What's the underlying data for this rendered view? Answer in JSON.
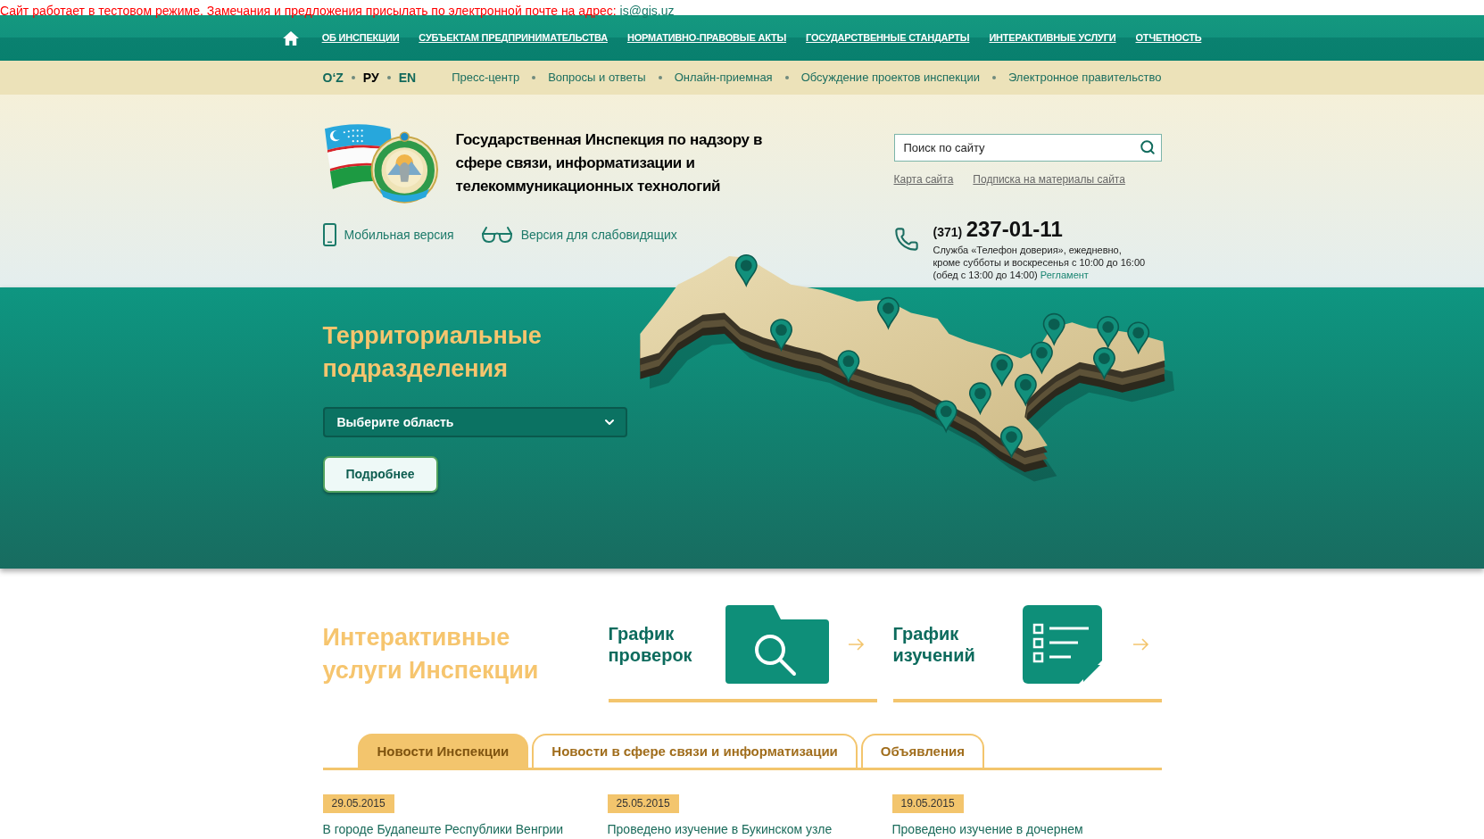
{
  "notice": {
    "text": "Сайт работает в тестовом режиме. Замечания и предложения присылать по электронной почте на адрес:",
    "email": "is@gis.uz"
  },
  "main_nav": {
    "items": [
      "ОБ ИНСПЕКЦИИ",
      "СУБЪЕКТАМ ПРЕДПРИНИМАТЕЛЬСТВА",
      "НОРМАТИВНО-ПРАВОВЫЕ АКТЫ",
      "ГОСУДАРСТВЕННЫЕ СТАНДАРТЫ",
      "ИНТЕРАКТИВНЫЕ УСЛУГИ",
      "ОТЧЕТНОСТЬ"
    ]
  },
  "languages": [
    {
      "label": "O‘Z",
      "selected": false
    },
    {
      "label": "РУ",
      "selected": true
    },
    {
      "label": "EN",
      "selected": false
    }
  ],
  "top_links": [
    "Пресс-центр",
    "Вопросы и ответы",
    "Онлайн-приемная",
    "Обсуждение проектов инспекции",
    "Электронное правительство"
  ],
  "header": {
    "title_lines": [
      "Государственная Инспекция по надзору в",
      "сфере связи, информатизации и",
      "телекоммуникационных технологий"
    ],
    "links": [
      {
        "kind": "mobile",
        "label": "Мобильная версия"
      },
      {
        "kind": "low_vision",
        "label": "Версия для слабовидящих"
      }
    ],
    "search": {
      "placeholder": "Поиск по сайту"
    },
    "site_links": [
      "Карта сайта",
      "Подписка на материалы сайта"
    ],
    "phone": {
      "code": "(371)",
      "number": "237-01-11",
      "note_lines": [
        "Служба «Телефон доверия», ежедневно,",
        "кроме субботы и воскресенья с 10:00 до 16:00",
        "(обед с 13:00 до 14:00)"
      ],
      "link": "Регламент"
    }
  },
  "territorial": {
    "title": "Территориальные подразделения",
    "select": {
      "value": "Выберите область"
    },
    "button": "Подробнее"
  },
  "interactive": {
    "title": "Интерактивные услуги Инспекции",
    "services": [
      {
        "kind": "folder_search",
        "title": "График проверок"
      },
      {
        "kind": "checklist",
        "title": "График изучений"
      }
    ]
  },
  "news_tabs": [
    {
      "label": "Новости Инспекции",
      "selected": true
    },
    {
      "label": "Новости в сфере связи и информатизации",
      "selected": false
    },
    {
      "label": "Объявления",
      "selected": false
    }
  ],
  "news": [
    {
      "date": "29.05.2015",
      "title": "В городе Будапеште Республики Венгрии"
    },
    {
      "date": "25.05.2015",
      "title": "Проведено изучение в Букинском узле"
    },
    {
      "date": "19.05.2015",
      "title": "Проведено изучение в дочернем"
    }
  ]
}
